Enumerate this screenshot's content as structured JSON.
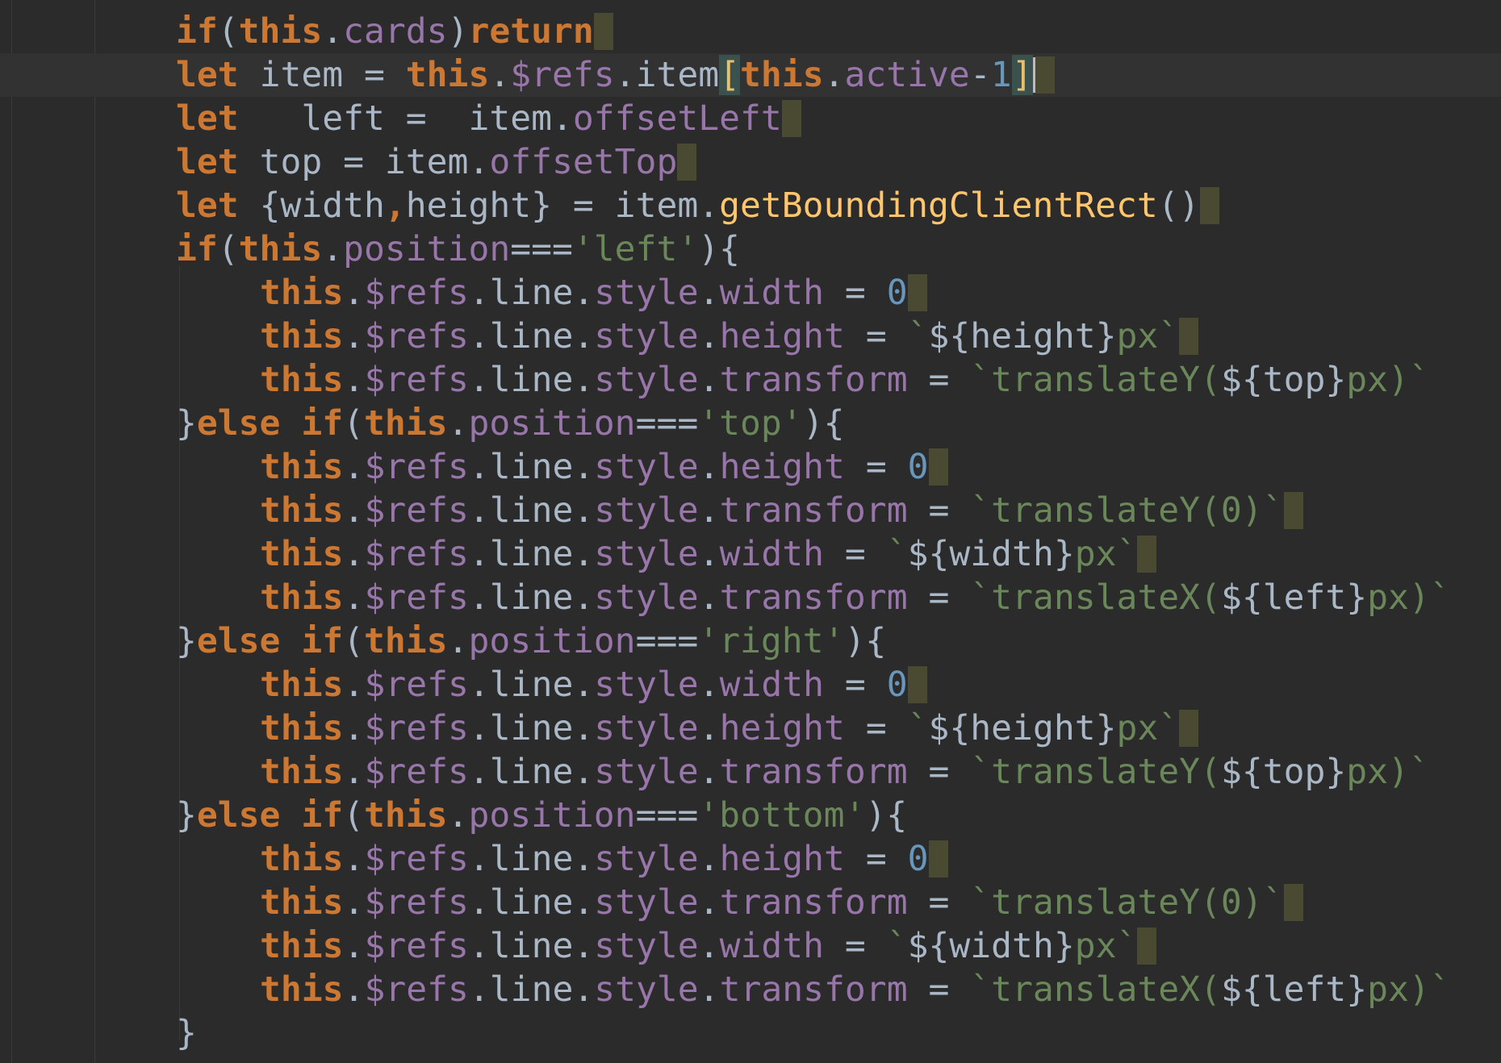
{
  "editor": {
    "theme_colors": {
      "background": "#2b2b2b",
      "keyword": "#cc7832",
      "property": "#9876aa",
      "string": "#6a8759",
      "number": "#6897bb",
      "function": "#ffc66d",
      "plain": "#a9b7c6",
      "brace_match": "#3b514d",
      "end_marker": "#4a4a32"
    },
    "lines": [
      {
        "current": false,
        "tokens": [
          {
            "t": "if",
            "c": "kw"
          },
          {
            "t": "(",
            "c": "plain"
          },
          {
            "t": "this",
            "c": "kw"
          },
          {
            "t": ".",
            "c": "plain"
          },
          {
            "t": "cards",
            "c": "prop"
          },
          {
            "t": ")",
            "c": "plain"
          },
          {
            "t": "return",
            "c": "kw"
          }
        ]
      },
      {
        "current": true,
        "tokens": [
          {
            "t": "let ",
            "c": "kw"
          },
          {
            "t": "item = ",
            "c": "plain"
          },
          {
            "t": "this",
            "c": "kw"
          },
          {
            "t": ".",
            "c": "plain"
          },
          {
            "t": "$refs",
            "c": "prop"
          },
          {
            "t": ".item",
            "c": "plain"
          },
          {
            "t": "[",
            "c": "brace"
          },
          {
            "t": "this",
            "c": "kw"
          },
          {
            "t": ".",
            "c": "plain"
          },
          {
            "t": "active",
            "c": "prop"
          },
          {
            "t": "-",
            "c": "plain"
          },
          {
            "t": "1",
            "c": "num"
          },
          {
            "t": "]",
            "c": "brace"
          }
        ]
      },
      {
        "current": false,
        "tokens": [
          {
            "t": "let",
            "c": "kw"
          },
          {
            "t": "   left =  item.",
            "c": "plain"
          },
          {
            "t": "offsetLeft",
            "c": "prop"
          }
        ]
      },
      {
        "current": false,
        "tokens": [
          {
            "t": "let ",
            "c": "kw"
          },
          {
            "t": "top = item.",
            "c": "plain"
          },
          {
            "t": "offsetTop",
            "c": "prop"
          }
        ]
      },
      {
        "current": false,
        "tokens": [
          {
            "t": "let ",
            "c": "kw"
          },
          {
            "t": "{width",
            "c": "plain"
          },
          {
            "t": ",",
            "c": "kw"
          },
          {
            "t": "height} = item.",
            "c": "plain"
          },
          {
            "t": "getBoundingClientRect",
            "c": "fn"
          },
          {
            "t": "()",
            "c": "plain"
          }
        ]
      },
      {
        "current": false,
        "tokens": [
          {
            "t": "if",
            "c": "kw"
          },
          {
            "t": "(",
            "c": "plain"
          },
          {
            "t": "this",
            "c": "kw"
          },
          {
            "t": ".",
            "c": "plain"
          },
          {
            "t": "position",
            "c": "prop"
          },
          {
            "t": "===",
            "c": "plain"
          },
          {
            "t": "'left'",
            "c": "str"
          },
          {
            "t": "){",
            "c": "plain"
          }
        ]
      },
      {
        "current": false,
        "indent": 2,
        "tokens": [
          {
            "t": "this",
            "c": "kw"
          },
          {
            "t": ".",
            "c": "plain"
          },
          {
            "t": "$refs",
            "c": "prop"
          },
          {
            "t": ".line.",
            "c": "plain"
          },
          {
            "t": "style",
            "c": "prop"
          },
          {
            "t": ".",
            "c": "plain"
          },
          {
            "t": "width",
            "c": "prop"
          },
          {
            "t": " = ",
            "c": "plain"
          },
          {
            "t": "0",
            "c": "num"
          }
        ]
      },
      {
        "current": false,
        "indent": 2,
        "tokens": [
          {
            "t": "this",
            "c": "kw"
          },
          {
            "t": ".",
            "c": "plain"
          },
          {
            "t": "$refs",
            "c": "prop"
          },
          {
            "t": ".line.",
            "c": "plain"
          },
          {
            "t": "style",
            "c": "prop"
          },
          {
            "t": ".",
            "c": "plain"
          },
          {
            "t": "height",
            "c": "prop"
          },
          {
            "t": " = ",
            "c": "plain"
          },
          {
            "t": "`",
            "c": "str"
          },
          {
            "t": "${height}",
            "c": "plain"
          },
          {
            "t": "px`",
            "c": "str"
          }
        ]
      },
      {
        "current": false,
        "indent": 2,
        "tokens": [
          {
            "t": "this",
            "c": "kw"
          },
          {
            "t": ".",
            "c": "plain"
          },
          {
            "t": "$refs",
            "c": "prop"
          },
          {
            "t": ".line.",
            "c": "plain"
          },
          {
            "t": "style",
            "c": "prop"
          },
          {
            "t": ".",
            "c": "plain"
          },
          {
            "t": "transform",
            "c": "prop"
          },
          {
            "t": " = ",
            "c": "plain"
          },
          {
            "t": "`translateY(",
            "c": "str"
          },
          {
            "t": "${top}",
            "c": "plain"
          },
          {
            "t": "px)`",
            "c": "str"
          }
        ]
      },
      {
        "current": false,
        "tokens": [
          {
            "t": "}",
            "c": "plain"
          },
          {
            "t": "else if",
            "c": "kw"
          },
          {
            "t": "(",
            "c": "plain"
          },
          {
            "t": "this",
            "c": "kw"
          },
          {
            "t": ".",
            "c": "plain"
          },
          {
            "t": "position",
            "c": "prop"
          },
          {
            "t": "===",
            "c": "plain"
          },
          {
            "t": "'top'",
            "c": "str"
          },
          {
            "t": "){",
            "c": "plain"
          }
        ]
      },
      {
        "current": false,
        "indent": 2,
        "tokens": [
          {
            "t": "this",
            "c": "kw"
          },
          {
            "t": ".",
            "c": "plain"
          },
          {
            "t": "$refs",
            "c": "prop"
          },
          {
            "t": ".line.",
            "c": "plain"
          },
          {
            "t": "style",
            "c": "prop"
          },
          {
            "t": ".",
            "c": "plain"
          },
          {
            "t": "height",
            "c": "prop"
          },
          {
            "t": " = ",
            "c": "plain"
          },
          {
            "t": "0",
            "c": "num"
          }
        ]
      },
      {
        "current": false,
        "indent": 2,
        "tokens": [
          {
            "t": "this",
            "c": "kw"
          },
          {
            "t": ".",
            "c": "plain"
          },
          {
            "t": "$refs",
            "c": "prop"
          },
          {
            "t": ".line.",
            "c": "plain"
          },
          {
            "t": "style",
            "c": "prop"
          },
          {
            "t": ".",
            "c": "plain"
          },
          {
            "t": "transform",
            "c": "prop"
          },
          {
            "t": " = ",
            "c": "plain"
          },
          {
            "t": "`translateY(0)`",
            "c": "str"
          }
        ]
      },
      {
        "current": false,
        "indent": 2,
        "tokens": [
          {
            "t": "this",
            "c": "kw"
          },
          {
            "t": ".",
            "c": "plain"
          },
          {
            "t": "$refs",
            "c": "prop"
          },
          {
            "t": ".line.",
            "c": "plain"
          },
          {
            "t": "style",
            "c": "prop"
          },
          {
            "t": ".",
            "c": "plain"
          },
          {
            "t": "width",
            "c": "prop"
          },
          {
            "t": " = ",
            "c": "plain"
          },
          {
            "t": "`",
            "c": "str"
          },
          {
            "t": "${width}",
            "c": "plain"
          },
          {
            "t": "px`",
            "c": "str"
          }
        ]
      },
      {
        "current": false,
        "indent": 2,
        "tokens": [
          {
            "t": "this",
            "c": "kw"
          },
          {
            "t": ".",
            "c": "plain"
          },
          {
            "t": "$refs",
            "c": "prop"
          },
          {
            "t": ".line.",
            "c": "plain"
          },
          {
            "t": "style",
            "c": "prop"
          },
          {
            "t": ".",
            "c": "plain"
          },
          {
            "t": "transform",
            "c": "prop"
          },
          {
            "t": " = ",
            "c": "plain"
          },
          {
            "t": "`translateX(",
            "c": "str"
          },
          {
            "t": "${left}",
            "c": "plain"
          },
          {
            "t": "px)`",
            "c": "str"
          }
        ]
      },
      {
        "current": false,
        "tokens": [
          {
            "t": "}",
            "c": "plain"
          },
          {
            "t": "else if",
            "c": "kw"
          },
          {
            "t": "(",
            "c": "plain"
          },
          {
            "t": "this",
            "c": "kw"
          },
          {
            "t": ".",
            "c": "plain"
          },
          {
            "t": "position",
            "c": "prop"
          },
          {
            "t": "===",
            "c": "plain"
          },
          {
            "t": "'right'",
            "c": "str"
          },
          {
            "t": "){",
            "c": "plain"
          }
        ]
      },
      {
        "current": false,
        "indent": 2,
        "tokens": [
          {
            "t": "this",
            "c": "kw"
          },
          {
            "t": ".",
            "c": "plain"
          },
          {
            "t": "$refs",
            "c": "prop"
          },
          {
            "t": ".line.",
            "c": "plain"
          },
          {
            "t": "style",
            "c": "prop"
          },
          {
            "t": ".",
            "c": "plain"
          },
          {
            "t": "width",
            "c": "prop"
          },
          {
            "t": " = ",
            "c": "plain"
          },
          {
            "t": "0",
            "c": "num"
          }
        ]
      },
      {
        "current": false,
        "indent": 2,
        "tokens": [
          {
            "t": "this",
            "c": "kw"
          },
          {
            "t": ".",
            "c": "plain"
          },
          {
            "t": "$refs",
            "c": "prop"
          },
          {
            "t": ".line.",
            "c": "plain"
          },
          {
            "t": "style",
            "c": "prop"
          },
          {
            "t": ".",
            "c": "plain"
          },
          {
            "t": "height",
            "c": "prop"
          },
          {
            "t": " = ",
            "c": "plain"
          },
          {
            "t": "`",
            "c": "str"
          },
          {
            "t": "${height}",
            "c": "plain"
          },
          {
            "t": "px`",
            "c": "str"
          }
        ]
      },
      {
        "current": false,
        "indent": 2,
        "tokens": [
          {
            "t": "this",
            "c": "kw"
          },
          {
            "t": ".",
            "c": "plain"
          },
          {
            "t": "$refs",
            "c": "prop"
          },
          {
            "t": ".line.",
            "c": "plain"
          },
          {
            "t": "style",
            "c": "prop"
          },
          {
            "t": ".",
            "c": "plain"
          },
          {
            "t": "transform",
            "c": "prop"
          },
          {
            "t": " = ",
            "c": "plain"
          },
          {
            "t": "`translateY(",
            "c": "str"
          },
          {
            "t": "${top}",
            "c": "plain"
          },
          {
            "t": "px)`",
            "c": "str"
          }
        ]
      },
      {
        "current": false,
        "tokens": [
          {
            "t": "}",
            "c": "plain"
          },
          {
            "t": "else if",
            "c": "kw"
          },
          {
            "t": "(",
            "c": "plain"
          },
          {
            "t": "this",
            "c": "kw"
          },
          {
            "t": ".",
            "c": "plain"
          },
          {
            "t": "position",
            "c": "prop"
          },
          {
            "t": "===",
            "c": "plain"
          },
          {
            "t": "'bottom'",
            "c": "str"
          },
          {
            "t": "){",
            "c": "plain"
          }
        ]
      },
      {
        "current": false,
        "indent": 2,
        "tokens": [
          {
            "t": "this",
            "c": "kw"
          },
          {
            "t": ".",
            "c": "plain"
          },
          {
            "t": "$refs",
            "c": "prop"
          },
          {
            "t": ".line.",
            "c": "plain"
          },
          {
            "t": "style",
            "c": "prop"
          },
          {
            "t": ".",
            "c": "plain"
          },
          {
            "t": "height",
            "c": "prop"
          },
          {
            "t": " = ",
            "c": "plain"
          },
          {
            "t": "0",
            "c": "num"
          }
        ]
      },
      {
        "current": false,
        "indent": 2,
        "tokens": [
          {
            "t": "this",
            "c": "kw"
          },
          {
            "t": ".",
            "c": "plain"
          },
          {
            "t": "$refs",
            "c": "prop"
          },
          {
            "t": ".line.",
            "c": "plain"
          },
          {
            "t": "style",
            "c": "prop"
          },
          {
            "t": ".",
            "c": "plain"
          },
          {
            "t": "transform",
            "c": "prop"
          },
          {
            "t": " = ",
            "c": "plain"
          },
          {
            "t": "`translateY(0)`",
            "c": "str"
          }
        ]
      },
      {
        "current": false,
        "indent": 2,
        "tokens": [
          {
            "t": "this",
            "c": "kw"
          },
          {
            "t": ".",
            "c": "plain"
          },
          {
            "t": "$refs",
            "c": "prop"
          },
          {
            "t": ".line.",
            "c": "plain"
          },
          {
            "t": "style",
            "c": "prop"
          },
          {
            "t": ".",
            "c": "plain"
          },
          {
            "t": "width",
            "c": "prop"
          },
          {
            "t": " = ",
            "c": "plain"
          },
          {
            "t": "`",
            "c": "str"
          },
          {
            "t": "${width}",
            "c": "plain"
          },
          {
            "t": "px`",
            "c": "str"
          }
        ]
      },
      {
        "current": false,
        "indent": 2,
        "tokens": [
          {
            "t": "this",
            "c": "kw"
          },
          {
            "t": ".",
            "c": "plain"
          },
          {
            "t": "$refs",
            "c": "prop"
          },
          {
            "t": ".line.",
            "c": "plain"
          },
          {
            "t": "style",
            "c": "prop"
          },
          {
            "t": ".",
            "c": "plain"
          },
          {
            "t": "transform",
            "c": "prop"
          },
          {
            "t": " = ",
            "c": "plain"
          },
          {
            "t": "`translateX(",
            "c": "str"
          },
          {
            "t": "${left}",
            "c": "plain"
          },
          {
            "t": "px)`",
            "c": "str"
          }
        ]
      },
      {
        "current": false,
        "tokens": [
          {
            "t": "}",
            "c": "plain"
          }
        ]
      }
    ],
    "end_markers": [
      0,
      1,
      2,
      3,
      4,
      6,
      7,
      10,
      11,
      12,
      15,
      16,
      19,
      20,
      21
    ]
  }
}
